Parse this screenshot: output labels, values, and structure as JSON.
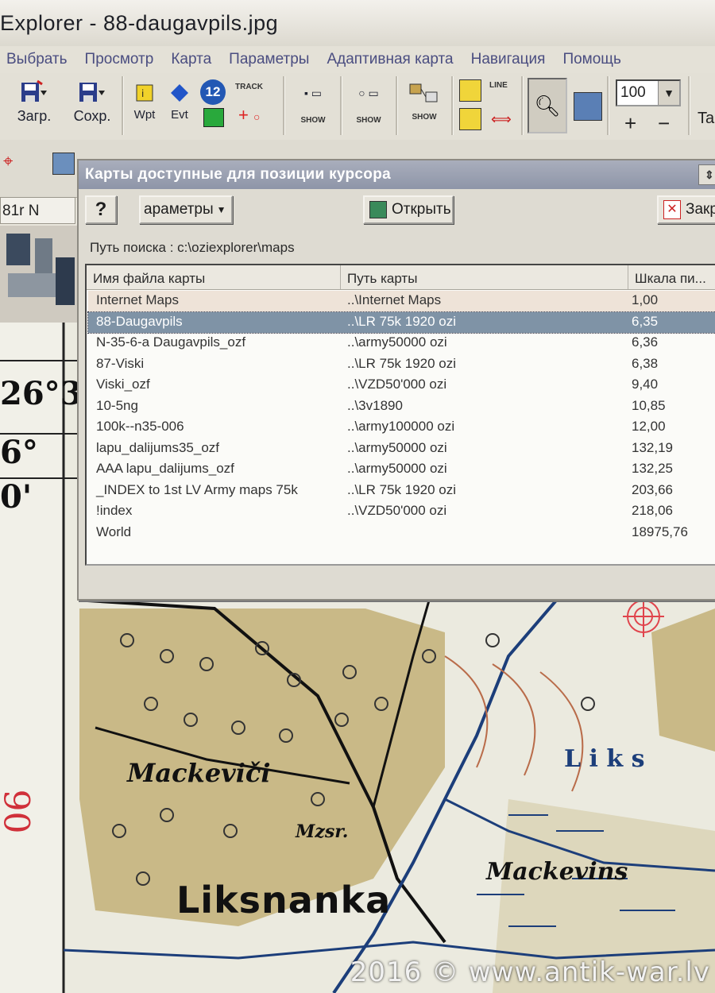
{
  "window": {
    "title": "Explorer - 88-daugavpils.jpg"
  },
  "menu": [
    "Выбрать",
    "Просмотр",
    "Карта",
    "Параметры",
    "Адаптивная карта",
    "Навигация",
    "Помощь"
  ],
  "toolbar": {
    "load_label": "Загр.",
    "save_label": "Сохр.",
    "wpt_label": "Wpt",
    "evt_label": "Evt",
    "track_label": "TRACK",
    "show_label": "SHOW",
    "line_label": "LINE",
    "num_badge": "12",
    "zoom_value": "100",
    "plus": "+",
    "minus": "−",
    "right_partial": "Ta"
  },
  "status": {
    "coord_text": "81r N"
  },
  "dialog": {
    "title": "Карты доступные для позиции курсора",
    "help_label": "?",
    "params_label": "араметры",
    "open_label": "Открыть",
    "close_label": "Закр",
    "search_path": "Путь поиска : c:\\oziexplorer\\maps",
    "columns": [
      "Имя файла карты",
      "Путь карты",
      "Шкала пи..."
    ],
    "selected_index": 1,
    "rows": [
      {
        "name": "Internet Maps",
        "path": "..\\Internet Maps",
        "scale": "1,00"
      },
      {
        "name": "88-Daugavpils",
        "path": "..\\LR 75k 1920 ozi",
        "scale": "6,35"
      },
      {
        "name": "N-35-6-a Daugavpils_ozf",
        "path": "..\\army50000 ozi",
        "scale": "6,36"
      },
      {
        "name": "87-Viski",
        "path": "..\\LR 75k 1920 ozi",
        "scale": "6,38"
      },
      {
        "name": "Viski_ozf",
        "path": "..\\VZD50'000 ozi",
        "scale": "9,40"
      },
      {
        "name": "10-5ng",
        "path": "..\\3v1890",
        "scale": "10,85"
      },
      {
        "name": "100k--n35-006",
        "path": "..\\army100000 ozi",
        "scale": "12,00"
      },
      {
        "name": "lapu_dalijums35_ozf",
        "path": "..\\army50000 ozi",
        "scale": "132,19"
      },
      {
        "name": "AAA lapu_dalijums_ozf",
        "path": "..\\army50000 ozi",
        "scale": "132,25"
      },
      {
        "name": "_INDEX to 1st LV Army maps 75k",
        "path": "..\\LR 75k 1920 ozi",
        "scale": "203,66"
      },
      {
        "name": "!index",
        "path": "..\\VZD50'000 ozi",
        "scale": "218,06"
      },
      {
        "name": "World",
        "path": "",
        "scale": "18975,76"
      }
    ]
  },
  "map": {
    "labels": {
      "mackevici": "Mackeviči",
      "mzsr": "Mzsr.",
      "liksnanka": "Liksnanka",
      "mackevins": "Mackevins",
      "liks": "L i k s",
      "deg1": "26°3",
      "deg2": "6°",
      "deg3": "0'",
      "side_num": "90"
    }
  },
  "watermark": "2016 © www.antik-war.lv"
}
